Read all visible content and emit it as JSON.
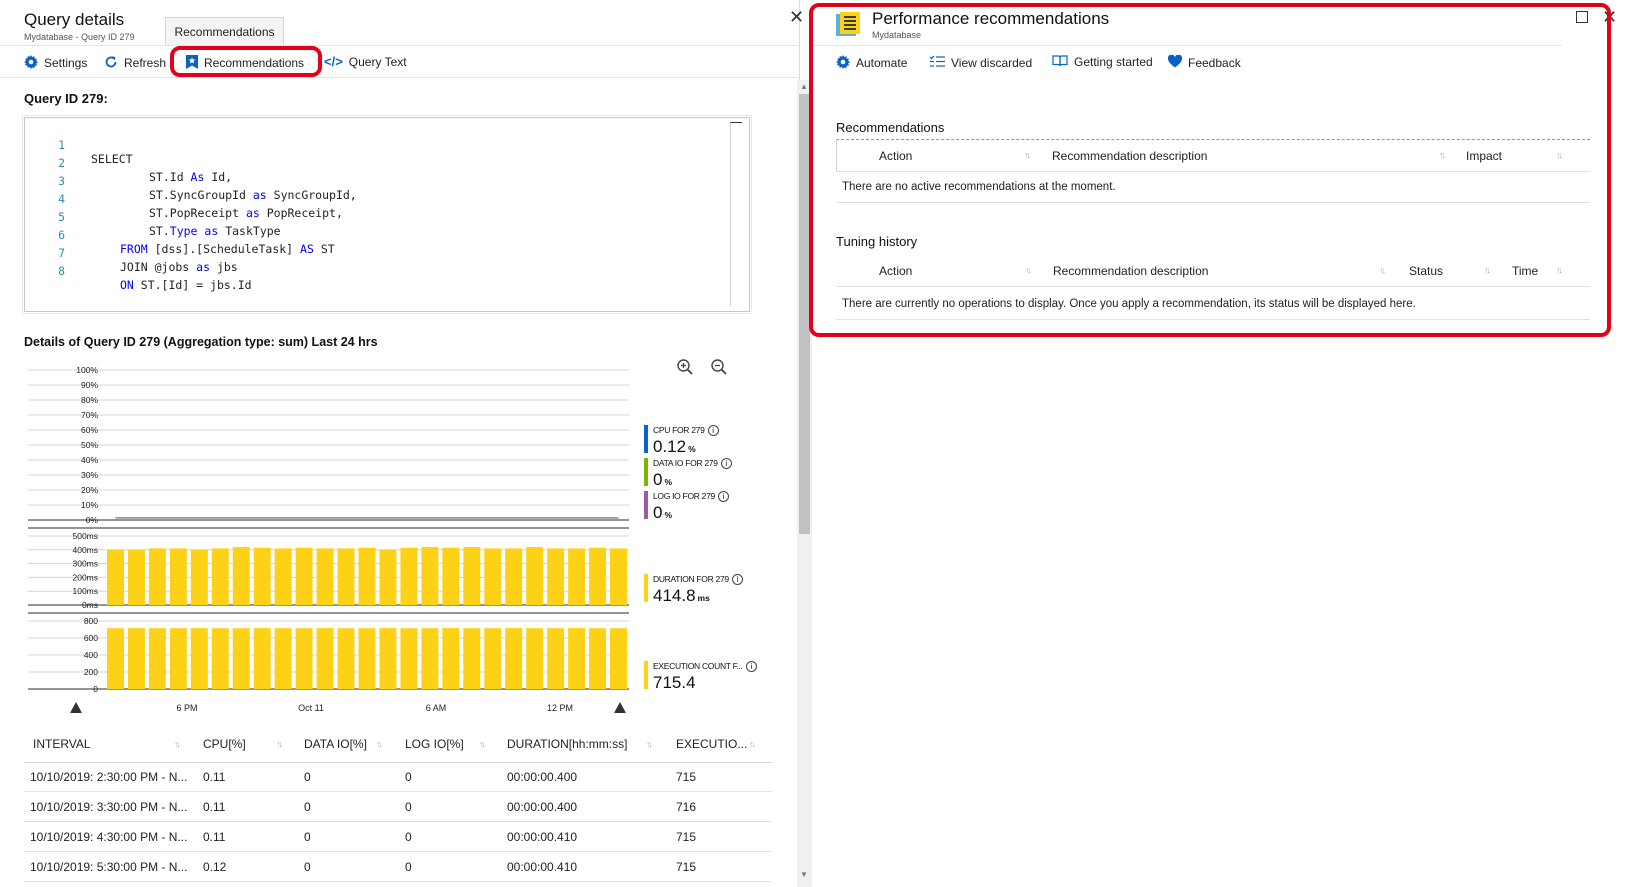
{
  "query_blade": {
    "title": "Query details",
    "subtitle": "Mydatabase - Query ID 279",
    "tab": "Recommendations",
    "toolbar": {
      "settings": "Settings",
      "refresh": "Refresh",
      "recommendations": "Recommendations",
      "query_text": "Query Text"
    },
    "query_heading": "Query ID 279:",
    "code_lines": [
      {
        "n": "1",
        "kw": "SELECT",
        "rest": ""
      },
      {
        "n": "2",
        "pre": "ST.Id ",
        "kw": "As",
        "rest": " Id,"
      },
      {
        "n": "3",
        "pre": "ST.SyncGroupId ",
        "kw": "as",
        "rest": " SyncGroupId,"
      },
      {
        "n": "4",
        "pre": "ST.PopReceipt ",
        "kw": "as",
        "rest": " PopReceipt,"
      },
      {
        "n": "5",
        "pre": "ST.",
        "kw": "Type",
        "kw2": "as",
        "rest": " TaskType"
      },
      {
        "n": "6",
        "kw": "FROM",
        "rest": " [dss].[ScheduleTask] ",
        "kw3": "AS",
        "rest2": " ST"
      },
      {
        "n": "7",
        "pre": "JOIN @jobs ",
        "kw": "as",
        "rest": " jbs"
      },
      {
        "n": "8",
        "kw": "ON",
        "rest": " ST.[Id] = jbs.Id"
      }
    ],
    "details_heading": "Details of Query ID 279 (Aggregation type: sum) Last 24 hrs",
    "icons": [
      "zoom-in-icon",
      "zoom-out-icon",
      "gear-icon",
      "refresh-icon",
      "recommendation-icon",
      "code-icon",
      "close-icon"
    ]
  },
  "chart_data": [
    {
      "type": "line",
      "title": "",
      "yticks": [
        "100%",
        "90%",
        "80%",
        "70%",
        "60%",
        "50%",
        "40%",
        "30%",
        "20%",
        "10%",
        "0%"
      ],
      "ylim": [
        0,
        100
      ],
      "series": [
        {
          "name": "CPU FOR 279",
          "color": "#0a62c9",
          "value": "0.12",
          "unit": "%",
          "values": [
            0.11,
            0.11,
            0.11,
            0.12,
            0.11,
            0.11,
            0.12,
            0.11,
            0.11,
            0.12,
            0.11,
            0.11,
            0.12,
            0.11,
            0.11,
            0.12,
            0.11,
            0.11,
            0.12,
            0.11,
            0.11,
            0.12,
            0.11,
            0.11,
            0.12
          ]
        },
        {
          "name": "DATA IO FOR 279",
          "color": "#7ab800",
          "value": "0",
          "unit": "%",
          "values": [
            0,
            0,
            0,
            0,
            0,
            0,
            0,
            0,
            0,
            0,
            0,
            0,
            0,
            0,
            0,
            0,
            0,
            0,
            0,
            0,
            0,
            0,
            0,
            0,
            0
          ]
        },
        {
          "name": "LOG IO FOR 279",
          "color": "#9b5ba5",
          "value": "0",
          "unit": "%",
          "values": [
            0,
            0,
            0,
            0,
            0,
            0,
            0,
            0,
            0,
            0,
            0,
            0,
            0,
            0,
            0,
            0,
            0,
            0,
            0,
            0,
            0,
            0,
            0,
            0,
            0
          ]
        }
      ]
    },
    {
      "type": "bar",
      "yticks": [
        "500ms",
        "400ms",
        "300ms",
        "200ms",
        "100ms",
        "0ms"
      ],
      "ylim": [
        0,
        500
      ],
      "series": [
        {
          "name": "DURATION FOR 279",
          "color": "#fcd116",
          "value": "414.8",
          "unit": "ms",
          "values": [
            400,
            400,
            410,
            410,
            400,
            410,
            420,
            415,
            410,
            415,
            410,
            410,
            415,
            400,
            415,
            420,
            415,
            420,
            410,
            410,
            420,
            410,
            410,
            415,
            410
          ]
        }
      ]
    },
    {
      "type": "bar",
      "yticks": [
        "800",
        "600",
        "400",
        "200",
        "0"
      ],
      "ylim": [
        0,
        800
      ],
      "xticks": [
        "6 PM",
        "Oct 11",
        "6 AM",
        "12 PM"
      ],
      "series": [
        {
          "name": "EXECUTION COUNT F...",
          "color": "#fcd116",
          "value": "715.4",
          "unit": "",
          "values": [
            715,
            716,
            715,
            715,
            716,
            715,
            715,
            716,
            715,
            715,
            716,
            715,
            715,
            716,
            715,
            715,
            716,
            715,
            715,
            716,
            715,
            715,
            716,
            715,
            715
          ]
        }
      ]
    }
  ],
  "grid": {
    "columns": [
      "INTERVAL",
      "CPU[%]",
      "DATA IO[%]",
      "LOG IO[%]",
      "DURATION[hh:mm:ss]",
      "EXECUTIO..."
    ],
    "rows": [
      [
        "10/10/2019: 2:30:00 PM - N...",
        "0.11",
        "0",
        "0",
        "00:00:00.400",
        "715"
      ],
      [
        "10/10/2019: 3:30:00 PM - N...",
        "0.11",
        "0",
        "0",
        "00:00:00.400",
        "716"
      ],
      [
        "10/10/2019: 4:30:00 PM - N...",
        "0.11",
        "0",
        "0",
        "00:00:00.410",
        "715"
      ],
      [
        "10/10/2019: 5:30:00 PM - N...",
        "0.12",
        "0",
        "0",
        "00:00:00.410",
        "715"
      ]
    ]
  },
  "recs_blade": {
    "title": "Performance recommendations",
    "subtitle": "Mydatabase",
    "toolbar": {
      "automate": "Automate",
      "view_discarded": "View discarded",
      "getting_started": "Getting started",
      "feedback": "Feedback"
    },
    "recommendations": {
      "heading": "Recommendations",
      "columns": [
        "Action",
        "Recommendation description",
        "Impact"
      ],
      "empty": "There are no active recommendations at the moment."
    },
    "tuning": {
      "heading": "Tuning history",
      "columns": [
        "Action",
        "Recommendation description",
        "Status",
        "Time"
      ],
      "empty": "There are currently no operations to display. Once you apply a recommendation, its status will be displayed here."
    }
  },
  "colors": {
    "accent": "#0a62c9",
    "highlight": "#e3001b",
    "bar": "#fcd116"
  }
}
